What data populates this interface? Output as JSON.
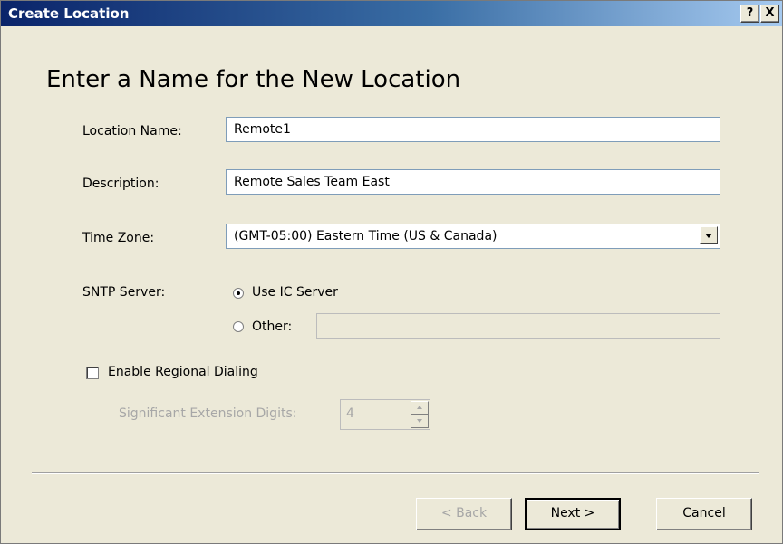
{
  "window": {
    "title": "Create Location",
    "help_button": "?",
    "close_button": "X"
  },
  "heading": "Enter a Name for the New Location",
  "form": {
    "location_name_label": "Location Name:",
    "location_name_value": "Remote1",
    "description_label": "Description:",
    "description_value": "Remote Sales Team East",
    "time_zone_label": "Time Zone:",
    "time_zone_value": "(GMT-05:00) Eastern Time (US & Canada)",
    "sntp_label": "SNTP Server:",
    "sntp_use_ic_label": "Use IC Server",
    "sntp_use_ic_checked": true,
    "sntp_other_label": "Other:",
    "sntp_other_value": "",
    "regional_dialing_label": "Enable Regional Dialing",
    "regional_dialing_checked": false,
    "sig_ext_label": "Significant Extension Digits:",
    "sig_ext_value": "4"
  },
  "buttons": {
    "back": "< Back",
    "next": "Next >",
    "cancel": "Cancel"
  },
  "colors": {
    "titlebar_start": "#0a246a",
    "titlebar_end": "#a6caf0",
    "dialog_bg": "#ece9d8"
  }
}
